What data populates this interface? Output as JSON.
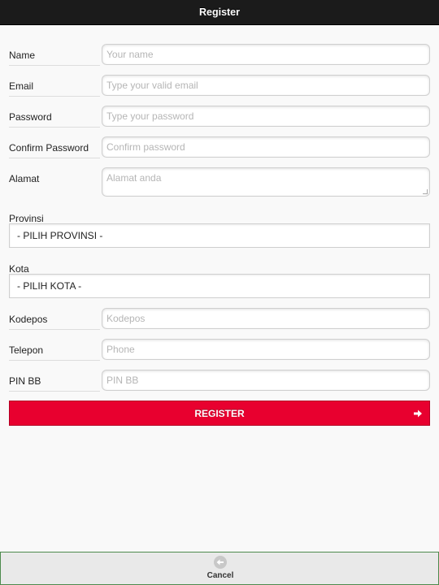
{
  "header": {
    "title": "Register"
  },
  "form": {
    "name": {
      "label": "Name",
      "placeholder": "Your name",
      "value": ""
    },
    "email": {
      "label": "Email",
      "placeholder": "Type your valid email",
      "value": ""
    },
    "password": {
      "label": "Password",
      "placeholder": "Type your password",
      "value": ""
    },
    "confirm_password": {
      "label": "Confirm Password",
      "placeholder": "Confirm password",
      "value": ""
    },
    "alamat": {
      "label": "Alamat",
      "placeholder": "Alamat anda",
      "value": ""
    },
    "provinsi": {
      "label": "Provinsi",
      "selected": "- PILIH PROVINSI -"
    },
    "kota": {
      "label": "Kota",
      "selected": "- PILIH KOTA -"
    },
    "kodepos": {
      "label": "Kodepos",
      "placeholder": "Kodepos",
      "value": ""
    },
    "telepon": {
      "label": "Telepon",
      "placeholder": "Phone",
      "value": ""
    },
    "pin_bb": {
      "label": "PIN BB",
      "placeholder": "PIN BB",
      "value": ""
    }
  },
  "register_button": {
    "label": "REGISTER",
    "icon": "arrow-right-icon",
    "color": "#e8002f"
  },
  "footer": {
    "cancel_label": "Cancel",
    "cancel_icon": "back-arrow-icon"
  },
  "colors": {
    "header_bg": "#1b1b1b",
    "accent": "#e8002f",
    "background": "#f9f9f9"
  }
}
